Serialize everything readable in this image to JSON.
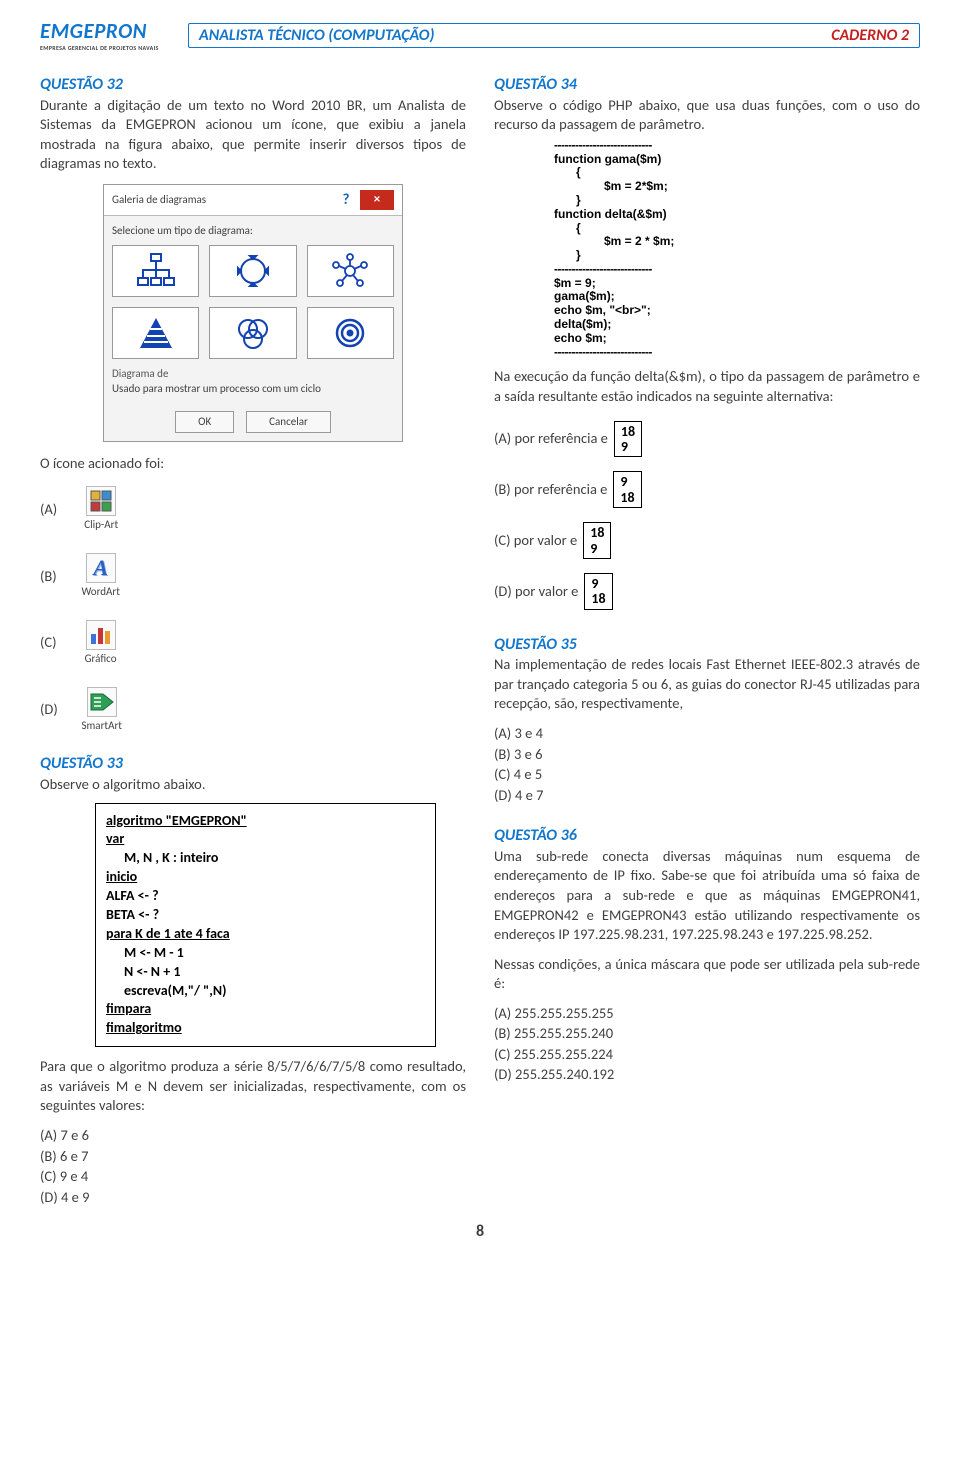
{
  "header": {
    "logo_title": "EMGEPRON",
    "logo_sub": "EMPRESA GERENCIAL DE PROJETOS NAVAIS",
    "exam_title": "ANALISTA TÉCNICO (COMPUTAÇÃO)",
    "booklet": "CADERNO 2"
  },
  "q32": {
    "title": "QUESTÃO 32",
    "prompt": "Durante a digitação de um texto no Word 2010 BR, um Analista de Sistemas da EMGEPRON acionou um ícone, que exibiu a janela mostrada na figura abaixo, que permite inserir diversos tipos de diagramas no texto.",
    "dialog": {
      "title": "Galeria de diagramas",
      "select_label": "Selecione um tipo de diagrama:",
      "desc_label": "Diagrama de",
      "desc_text": "Usado para mostrar um processo com um ciclo",
      "ok": "OK",
      "cancel": "Cancelar"
    },
    "after_dialog": "O ícone acionado foi:",
    "options": {
      "a_letter": "(A)",
      "a_icon_label": "Clip-Art",
      "b_letter": "(B)",
      "b_icon_label": "WordArt",
      "c_letter": "(C)",
      "c_icon_label": "Gráfico",
      "d_letter": "(D)",
      "d_icon_label": "SmartArt"
    }
  },
  "q33": {
    "title": "QUESTÃO 33",
    "prompt": "Observe o algoritmo abaixo.",
    "algo": {
      "l1": "algoritmo \"EMGEPRON\"",
      "l2": "var",
      "l3": "M, N , K : inteiro",
      "l4": "inicio",
      "l5": "ALFA <- ?",
      "l6": "BETA <- ?",
      "l7": "para K de 1 ate 4 faca",
      "l8": "M <- M - 1",
      "l9": "N <- N + 1",
      "l10": "escreva(M,\"/ \",N)",
      "l11": "fimpara",
      "l12": "fimalgoritmo"
    },
    "after": "Para que o algoritmo produza a série 8/5/7/6/6/7/5/8 como resultado, as variáveis M e N devem ser inicializadas, respectivamente, com os seguintes valores:",
    "opts": {
      "a": "(A)  7 e 6",
      "b": "(B)  6 e 7",
      "c": "(C)  9 e 4",
      "d": "(D)  4 e 9"
    }
  },
  "q34": {
    "title": "QUESTÃO 34",
    "prompt": "Observe o código PHP abaixo, que usa duas funções, com o uso do recurso da passagem de parâmetro.",
    "code": {
      "dash": "----------------------------",
      "l1": "function   gama($m)",
      "l2": "{",
      "l3": "$m = 2*$m;",
      "l4": "}",
      "l5": "function   delta(&$m)",
      "l6": "{",
      "l7": "$m = 2 * $m;",
      "l8": "}",
      "l9": "$m = 9;",
      "l10": "gama($m);",
      "l11": "echo $m, \"<br>\";",
      "l12": "delta($m);",
      "l13": "echo $m;"
    },
    "after": "Na execução da função delta(&$m), o tipo da passagem de parâmetro e a saída resultante estão indicados na seguinte alternativa:",
    "opts": {
      "a_l": "(A)  por referência e",
      "a_v1": "18",
      "a_v2": "9",
      "b_l": "(B)  por referência e",
      "b_v1": "9",
      "b_v2": "18",
      "c_l": "(C)  por valor e",
      "c_v1": "18",
      "c_v2": "9",
      "d_l": "(D)  por valor e",
      "d_v1": "9",
      "d_v2": "18"
    }
  },
  "q35": {
    "title": "QUESTÃO 35",
    "prompt": "Na implementação de redes locais Fast Ethernet IEEE-802.3 através de par trançado categoria 5 ou 6, as guias do conector RJ-45 utilizadas para recepção, são, respectivamente,",
    "opts": {
      "a": "(A)  3 e 4",
      "b": "(B)  3 e 6",
      "c": "(C)  4 e 5",
      "d": "(D)  4 e 7"
    }
  },
  "q36": {
    "title": "QUESTÃO 36",
    "prompt": "Uma sub-rede conecta diversas máquinas num esquema de endereçamento de IP fixo. Sabe-se que foi atribuída uma só faixa de endereços para a sub-rede e que as máquinas EMGEPRON41, EMGEPRON42 e EMGEPRON43 estão utilizando respectivamente os endereços IP 197.225.98.231, 197.225.98.243 e  197.225.98.252.",
    "after": "Nessas condições, a única máscara que pode ser utilizada pela sub-rede é:",
    "opts": {
      "a": "(A)  255.255.255.255",
      "b": "(B)  255.255.255.240",
      "c": "(C)  255.255.255.224",
      "d": "(D)  255.255.240.192"
    }
  },
  "page_number": "8"
}
